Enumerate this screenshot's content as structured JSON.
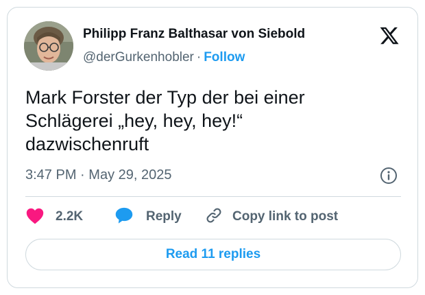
{
  "author": {
    "name": "Philipp Franz Balthasar von Siebold",
    "handle": "@derGurkenhobler",
    "separator": "·",
    "follow_label": "Follow"
  },
  "tweet": {
    "text_lines": [
      "Mark Forster der Typ der bei einer",
      "Schlägerei „hey, hey, hey!“",
      "dazwischenruft"
    ],
    "time": "3:47 PM",
    "date_separator": "·",
    "date": "May 29, 2025"
  },
  "actions": {
    "like_count": "2.2K",
    "reply_label": "Reply",
    "copy_label": "Copy link to post"
  },
  "read_replies_label": "Read 11 replies",
  "icons": {
    "logo": "x-logo-icon",
    "info": "info-icon",
    "like": "heart-icon",
    "reply": "speech-bubble-icon",
    "copy": "link-icon"
  },
  "colors": {
    "accent": "#1d9bf0",
    "like": "#f91880",
    "text_primary": "#0f1419",
    "text_secondary": "#536471",
    "border": "#cfd9de"
  }
}
